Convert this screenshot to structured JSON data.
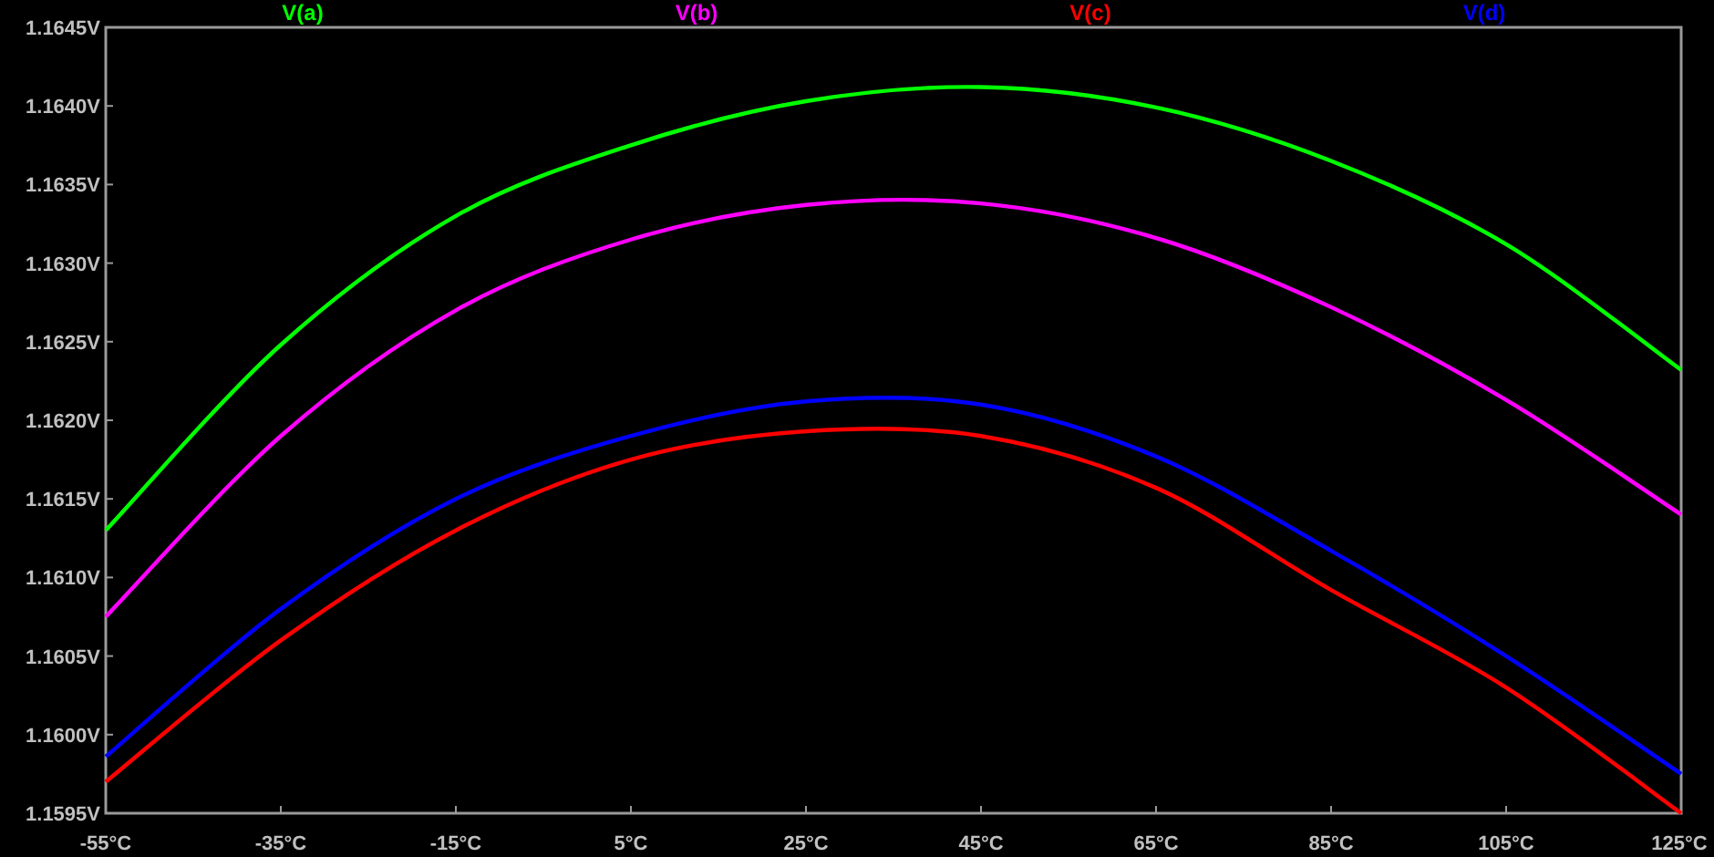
{
  "plot": {
    "chart_data": {
      "type": "line",
      "x": [
        -55,
        -35,
        -15,
        5,
        25,
        45,
        65,
        85,
        105,
        125
      ],
      "series": [
        {
          "name": "V(a)",
          "color": "#00ff00",
          "values": [
            1.1613,
            1.16248,
            1.1633,
            1.16375,
            1.16403,
            1.16412,
            1.16399,
            1.16365,
            1.16312,
            1.16232
          ]
        },
        {
          "name": "V(b)",
          "color": "#ff00ff",
          "values": [
            1.16075,
            1.1619,
            1.1627,
            1.16315,
            1.16337,
            1.16338,
            1.16316,
            1.16272,
            1.16213,
            1.1614
          ]
        },
        {
          "name": "V(c)",
          "color": "#ff0000",
          "values": [
            1.1597,
            1.1606,
            1.1613,
            1.16175,
            1.16193,
            1.1619,
            1.16157,
            1.16092,
            1.1603,
            1.1595
          ]
        },
        {
          "name": "V(d)",
          "color": "#0000ff",
          "values": [
            1.15986,
            1.1608,
            1.1615,
            1.1619,
            1.16212,
            1.1621,
            1.16177,
            1.16117,
            1.1605,
            1.15975
          ]
        }
      ],
      "xlim": [
        -55,
        125
      ],
      "ylim": [
        1.1595,
        1.1645
      ],
      "xticks": [
        {
          "value": -55,
          "label": "-55°C"
        },
        {
          "value": -35,
          "label": "-35°C"
        },
        {
          "value": -15,
          "label": "-15°C"
        },
        {
          "value": 5,
          "label": "5°C"
        },
        {
          "value": 25,
          "label": "25°C"
        },
        {
          "value": 45,
          "label": "45°C"
        },
        {
          "value": 65,
          "label": "65°C"
        },
        {
          "value": 85,
          "label": "85°C"
        },
        {
          "value": 105,
          "label": "105°C"
        },
        {
          "value": 125,
          "label": "125°C"
        }
      ],
      "yticks": [
        {
          "value": 1.1595,
          "label": "1.1595V"
        },
        {
          "value": 1.16,
          "label": "1.1600V"
        },
        {
          "value": 1.1605,
          "label": "1.1605V"
        },
        {
          "value": 1.161,
          "label": "1.1610V"
        },
        {
          "value": 1.1615,
          "label": "1.1615V"
        },
        {
          "value": 1.162,
          "label": "1.1620V"
        },
        {
          "value": 1.1625,
          "label": "1.1625V"
        },
        {
          "value": 1.163,
          "label": "1.1630V"
        },
        {
          "value": 1.1635,
          "label": "1.1635V"
        },
        {
          "value": 1.164,
          "label": "1.1640V"
        },
        {
          "value": 1.1645,
          "label": "1.1645V"
        }
      ]
    }
  }
}
